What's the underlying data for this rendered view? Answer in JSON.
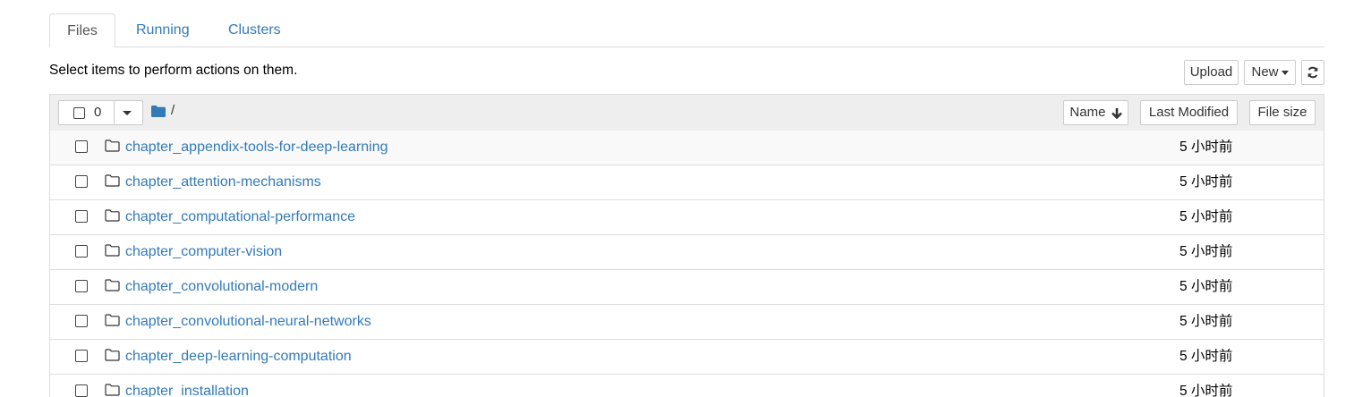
{
  "tabs": [
    {
      "label": "Files",
      "active": true
    },
    {
      "label": "Running",
      "active": false
    },
    {
      "label": "Clusters",
      "active": false
    }
  ],
  "instructions": "Select items to perform actions on them.",
  "toolbar": {
    "upload_label": "Upload",
    "new_label": "New",
    "refresh_icon": "refresh-icon"
  },
  "list_header": {
    "selected_count": "0",
    "path": "/",
    "sort_name_label": "Name",
    "sort_modified_label": "Last Modified",
    "sort_size_label": "File size"
  },
  "rows": [
    {
      "name": "chapter_appendix-tools-for-deep-learning",
      "modified": "5 小时前"
    },
    {
      "name": "chapter_attention-mechanisms",
      "modified": "5 小时前"
    },
    {
      "name": "chapter_computational-performance",
      "modified": "5 小时前"
    },
    {
      "name": "chapter_computer-vision",
      "modified": "5 小时前"
    },
    {
      "name": "chapter_convolutional-modern",
      "modified": "5 小时前"
    },
    {
      "name": "chapter_convolutional-neural-networks",
      "modified": "5 小时前"
    },
    {
      "name": "chapter_deep-learning-computation",
      "modified": "5 小时前"
    },
    {
      "name": "chapter_installation",
      "modified": "5 小时前"
    }
  ],
  "colors": {
    "link": "#337ab7",
    "header_bg": "#eeeeee",
    "border": "#dddddd",
    "folder_icon": "#337ab7"
  }
}
